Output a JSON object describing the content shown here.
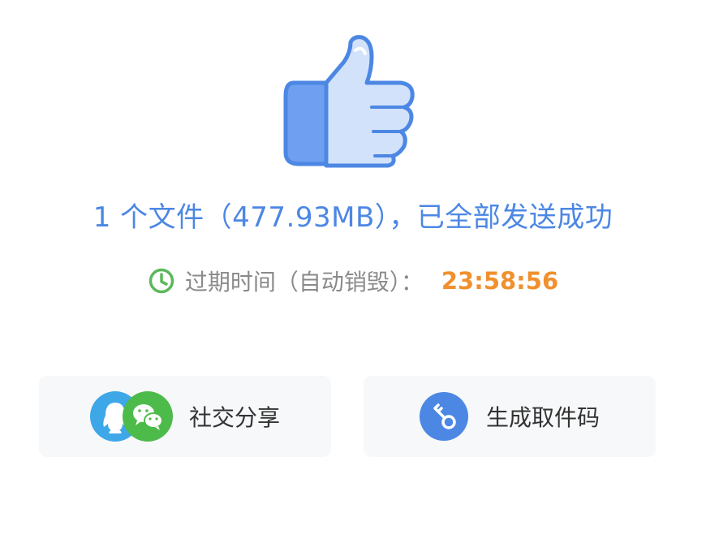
{
  "result": {
    "headline": "1 个文件（477.93MB），已全部发送成功",
    "expiry_label": "过期时间（自动销毁）：",
    "countdown": "23:58:56"
  },
  "actions": {
    "share_label": "社交分享",
    "code_label": "生成取件码"
  },
  "icons": {
    "thumb": "thumbs-up-icon",
    "clock": "clock-icon",
    "qq": "qq-icon",
    "wechat": "wechat-icon",
    "key": "key-icon"
  },
  "colors": {
    "accent_blue": "#4c87e4",
    "countdown_orange": "#f0902e",
    "clock_green": "#5cb85c",
    "qq_blue": "#3ea7e8",
    "wechat_green": "#4dbb4a",
    "button_bg": "#f7f8fa"
  }
}
